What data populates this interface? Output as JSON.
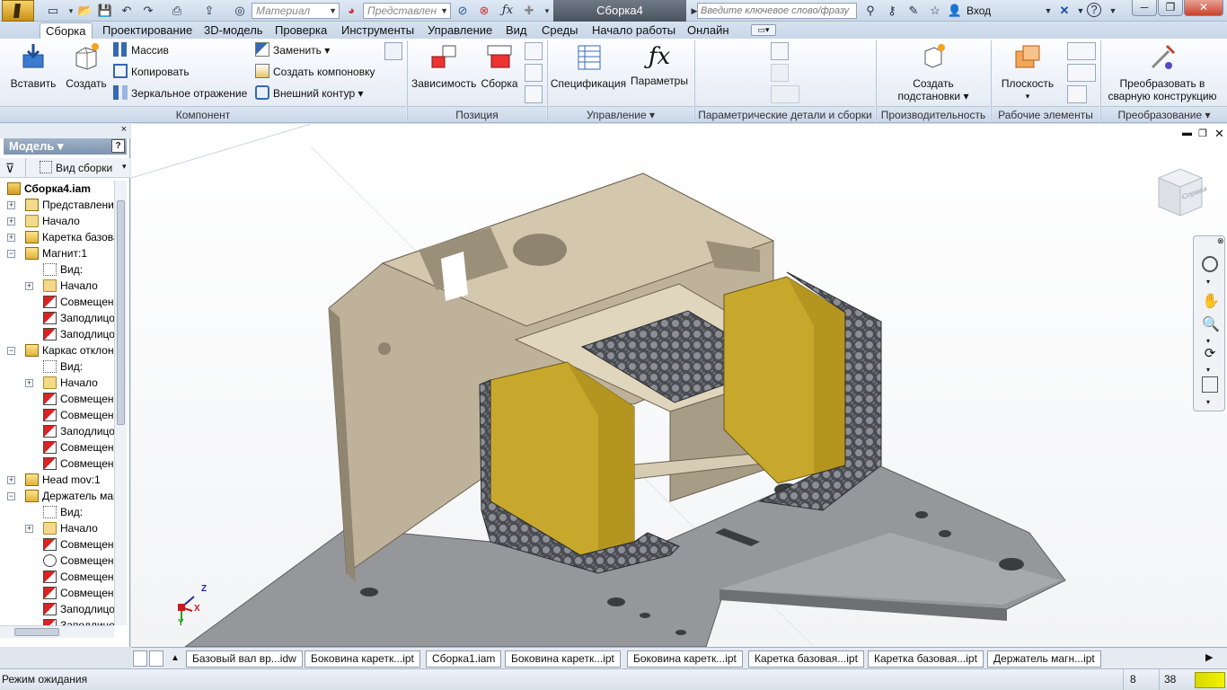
{
  "titlebar": {
    "document_title": "Сборка4",
    "material_combo": "Материал",
    "representation_combo": "Представлен",
    "help_search_placeholder": "Введите ключевое слово/фразу",
    "signin_label": "Вход",
    "window_controls": {
      "minimize": "─",
      "restore": "❐",
      "close": "✕"
    },
    "help_glyph": "?"
  },
  "tabs": [
    {
      "label": "Сборка",
      "active": true
    },
    {
      "label": "Проектирование"
    },
    {
      "label": "3D-модель"
    },
    {
      "label": "Проверка"
    },
    {
      "label": "Инструменты"
    },
    {
      "label": "Управление"
    },
    {
      "label": "Вид"
    },
    {
      "label": "Среды"
    },
    {
      "label": "Начало работы"
    },
    {
      "label": "Онлайн"
    }
  ],
  "ribbon": {
    "groups": {
      "component": "Компонент",
      "position": "Позиция",
      "manage": "Управление ▾",
      "parametric": "Параметрические детали и сборки",
      "productivity": "Производительность",
      "work_features": "Рабочие элементы",
      "convert": "Преобразование ▾"
    },
    "buttons": {
      "insert": "Вставить",
      "create": "Создать",
      "pattern": "Массив",
      "copy": "Копировать",
      "mirror": "Зеркальное отражение",
      "replace": "Заменить",
      "create_layout": "Создать компоновку",
      "shrinkwrap": "Внешний контур",
      "constraints": "Зависимость",
      "assemble": "Сборка",
      "bom": "Спецификация",
      "parameters": "Параметры",
      "create_substitutes_l1": "Создать",
      "create_substitutes_l2": "подстановки",
      "plane": "Плоскость",
      "convert_l1": "Преобразовать в",
      "convert_l2": "сварную конструкцию"
    }
  },
  "browser": {
    "title": "Модель ▾",
    "view_label": "Вид сборки",
    "help_glyph": "?",
    "tree": [
      {
        "label": "Сборка4.iam",
        "indent": 0,
        "icon": "assembly-icon",
        "bold": true
      },
      {
        "label": "Представления",
        "indent": 1,
        "icon": "representations-icon",
        "exp": "+"
      },
      {
        "label": "Начало",
        "indent": 1,
        "icon": "folder-icon",
        "exp": "+"
      },
      {
        "label": "Каретка базова",
        "indent": 1,
        "icon": "part-icon",
        "exp": "+"
      },
      {
        "label": "Магнит:1",
        "indent": 1,
        "icon": "part-icon",
        "exp": "−"
      },
      {
        "label": "Вид:",
        "indent": 2,
        "icon": "view-icon"
      },
      {
        "label": "Начало",
        "indent": 2,
        "icon": "folder-icon",
        "exp": "+"
      },
      {
        "label": "Совмещени",
        "indent": 2,
        "icon": "constraint-icon"
      },
      {
        "label": "Заподлицо:",
        "indent": 2,
        "icon": "constraint-icon"
      },
      {
        "label": "Заподлицо:",
        "indent": 2,
        "icon": "constraint-icon"
      },
      {
        "label": "Каркас отклоня",
        "indent": 1,
        "icon": "part-icon",
        "exp": "−"
      },
      {
        "label": "Вид:",
        "indent": 2,
        "icon": "view-icon"
      },
      {
        "label": "Начало",
        "indent": 2,
        "icon": "folder-icon",
        "exp": "+"
      },
      {
        "label": "Совмещени",
        "indent": 2,
        "icon": "constraint-icon"
      },
      {
        "label": "Совмещени",
        "indent": 2,
        "icon": "constraint-icon"
      },
      {
        "label": "Заподлицо:",
        "indent": 2,
        "icon": "constraint-icon"
      },
      {
        "label": "Совмещени",
        "indent": 2,
        "icon": "constraint-icon"
      },
      {
        "label": "Совмещени",
        "indent": 2,
        "icon": "constraint-icon"
      },
      {
        "label": "Head mov:1",
        "indent": 1,
        "icon": "part-icon",
        "exp": "+"
      },
      {
        "label": "Держатель маг",
        "indent": 1,
        "icon": "part-icon",
        "exp": "−"
      },
      {
        "label": "Вид:",
        "indent": 2,
        "icon": "view-icon"
      },
      {
        "label": "Начало",
        "indent": 2,
        "icon": "folder-icon",
        "exp": "+"
      },
      {
        "label": "Совмещени",
        "indent": 2,
        "icon": "constraint-icon"
      },
      {
        "label": "Совмещени",
        "indent": 2,
        "icon": "angle-constraint-icon"
      },
      {
        "label": "Совмещени",
        "indent": 2,
        "icon": "constraint-icon"
      },
      {
        "label": "Совмещени",
        "indent": 2,
        "icon": "constraint-icon"
      },
      {
        "label": "Заподлицо:",
        "indent": 2,
        "icon": "constraint-icon"
      },
      {
        "label": "Заподлицо:",
        "indent": 2,
        "icon": "constraint-icon"
      }
    ]
  },
  "viewcube_label": "Справа",
  "axes": {
    "x": "X",
    "y": "Y",
    "z": "Z"
  },
  "doc_tabs": [
    "Базовый вал вр...idw",
    "Боковина каретк...ipt",
    "Сборка1.iam",
    "Боковина каретк...ipt",
    "Боковина каретк...ipt",
    "Каретка базовая...ipt",
    "Каретка базовая...ipt",
    "Держатель магн...ipt"
  ],
  "status": {
    "text": "Режим ожидания",
    "count_a": "8",
    "count_b": "38"
  }
}
